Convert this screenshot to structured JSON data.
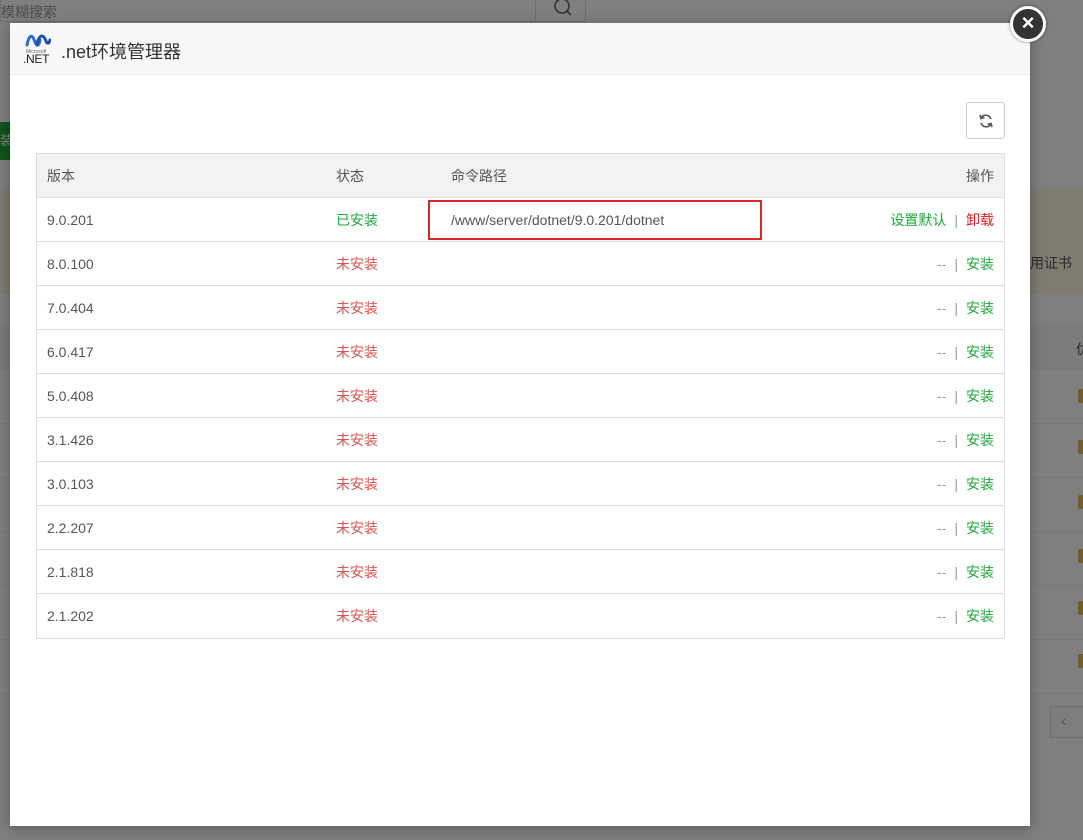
{
  "background": {
    "search_placeholder": "模糊搜索",
    "green_button_fragment": "装",
    "notice_fragment": "用证书",
    "column_fragment": "优"
  },
  "modal": {
    "logo": {
      "brand_small": "Microsoft",
      "brand_text": ".NET"
    },
    "title": ".net环境管理器",
    "close_icon": "close-icon",
    "refresh_icon": "refresh-icon"
  },
  "table": {
    "headers": {
      "version": "版本",
      "status": "状态",
      "path": "命令路径",
      "ops": "操作"
    },
    "rows": [
      {
        "version": "9.0.201",
        "status": "已安装",
        "installed": true,
        "path": "/www/server/dotnet/9.0.201/dotnet",
        "op_primary": "设置默认",
        "sep": "|",
        "op_secondary": "卸载"
      },
      {
        "version": "8.0.100",
        "status": "未安装",
        "installed": false,
        "path": "",
        "op_primary": "--",
        "sep": "|",
        "op_secondary": "安装"
      },
      {
        "version": "7.0.404",
        "status": "未安装",
        "installed": false,
        "path": "",
        "op_primary": "--",
        "sep": "|",
        "op_secondary": "安装"
      },
      {
        "version": "6.0.417",
        "status": "未安装",
        "installed": false,
        "path": "",
        "op_primary": "--",
        "sep": "|",
        "op_secondary": "安装"
      },
      {
        "version": "5.0.408",
        "status": "未安装",
        "installed": false,
        "path": "",
        "op_primary": "--",
        "sep": "|",
        "op_secondary": "安装"
      },
      {
        "version": "3.1.426",
        "status": "未安装",
        "installed": false,
        "path": "",
        "op_primary": "--",
        "sep": "|",
        "op_secondary": "安装"
      },
      {
        "version": "3.0.103",
        "status": "未安装",
        "installed": false,
        "path": "",
        "op_primary": "--",
        "sep": "|",
        "op_secondary": "安装"
      },
      {
        "version": "2.2.207",
        "status": "未安装",
        "installed": false,
        "path": "",
        "op_primary": "--",
        "sep": "|",
        "op_secondary": "安装"
      },
      {
        "version": "2.1.818",
        "status": "未安装",
        "installed": false,
        "path": "",
        "op_primary": "--",
        "sep": "|",
        "op_secondary": "安装"
      },
      {
        "version": "2.1.202",
        "status": "未安装",
        "installed": false,
        "path": "",
        "op_primary": "--",
        "sep": "|",
        "op_secondary": "安装"
      }
    ]
  },
  "colors": {
    "installed": "#20a53a",
    "not_installed": "#d9534f",
    "danger": "#e02020",
    "highlight_box": "#d92626"
  }
}
